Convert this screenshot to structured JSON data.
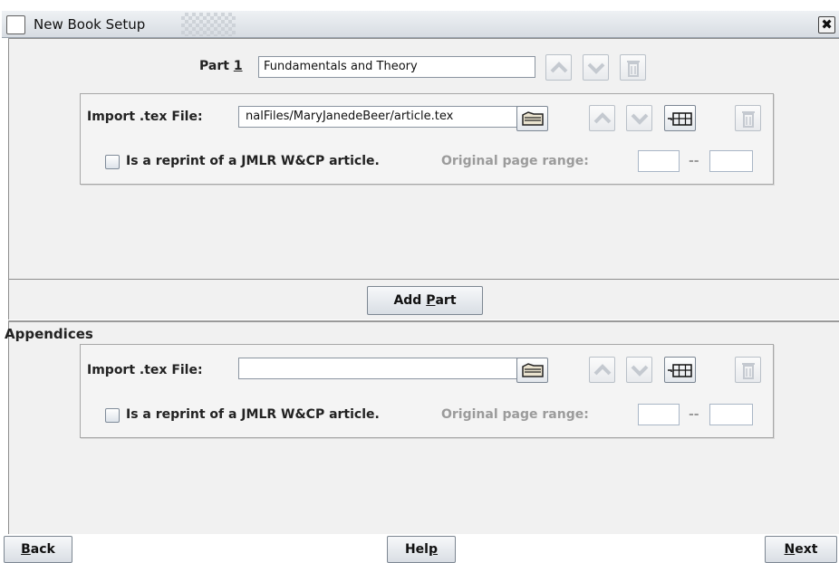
{
  "window": {
    "title": "New Book Setup",
    "close_glyph": "✖"
  },
  "part": {
    "label_prefix": "Part ",
    "number": "1",
    "title_value": "Fundamentals and Theory",
    "import_label": "Import .tex File:",
    "file_value": "nalFiles/MaryJanedeBeer/article.tex",
    "reprint_label": "Is a reprint of a JMLR W&CP article.",
    "page_range_label": "Original page range:",
    "range_separator": "--",
    "range_start": "",
    "range_end": ""
  },
  "add_part": {
    "prefix": "Add ",
    "mnemonic": "P",
    "suffix": "art"
  },
  "appendices": {
    "heading": "Appendices",
    "import_label": "Import .tex File:",
    "file_value": "",
    "reprint_label": "Is a reprint of a JMLR W&CP article.",
    "page_range_label": "Original page range:",
    "range_separator": "--",
    "range_start": "",
    "range_end": ""
  },
  "footer": {
    "back": {
      "mnemonic": "B",
      "rest": "ack"
    },
    "help": {
      "prefix": "Hel",
      "mnemonic": "p"
    },
    "next": {
      "mnemonic": "N",
      "rest": "ext"
    }
  },
  "icons": [
    "folder-icon",
    "move-up-icon",
    "move-down-icon",
    "delete-icon",
    "table-icon",
    "close-icon"
  ]
}
